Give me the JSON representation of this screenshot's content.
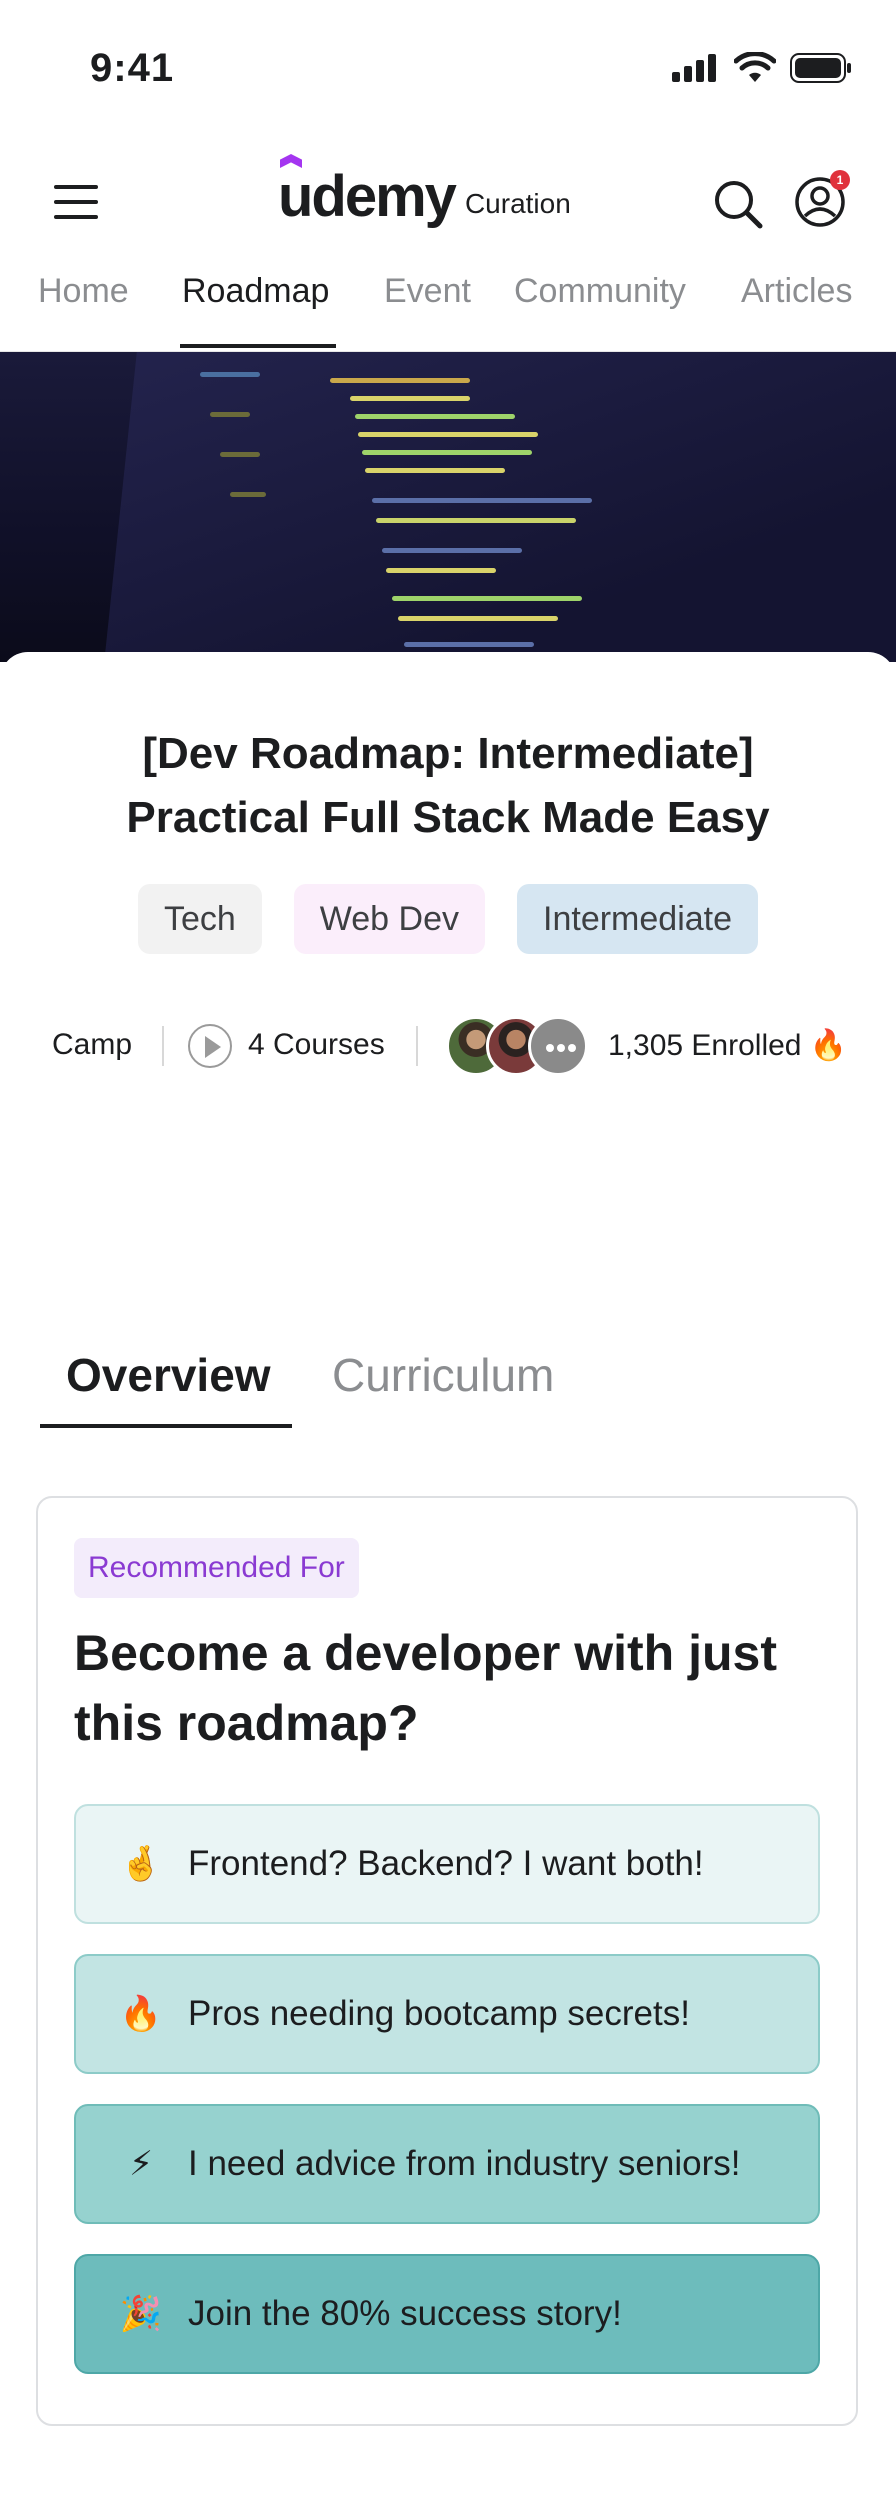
{
  "status": {
    "time": "9:41"
  },
  "header": {
    "brand": "udemy",
    "brand_sub": "Curation",
    "notification_count": "1"
  },
  "nav": {
    "tabs": [
      {
        "label": "Home"
      },
      {
        "label": "Roadmap"
      },
      {
        "label": "Event"
      },
      {
        "label": "Community"
      },
      {
        "label": "Articles"
      }
    ],
    "active": "Roadmap"
  },
  "roadmap": {
    "title_line1": "[Dev Roadmap: Intermediate]",
    "title_line2": "Practical Full Stack Made Easy",
    "tags": [
      "Tech",
      "Web Dev",
      "Intermediate"
    ],
    "type": "Camp",
    "courses": "4 Courses",
    "enrolled": "1,305 Enrolled 🔥"
  },
  "content_tabs": {
    "tabs": [
      {
        "label": "Overview"
      },
      {
        "label": "Curriculum"
      }
    ],
    "active": "Overview"
  },
  "recommended": {
    "label": "Recommended For",
    "heading": "Become a developer with just this roadmap?",
    "items": [
      {
        "emoji": "🤞",
        "text": "Frontend? Backend? I want both!"
      },
      {
        "emoji": "🔥",
        "text": "Pros needing bootcamp secrets!"
      },
      {
        "emoji": "⚡",
        "text": "I need advice from industry seniors!"
      },
      {
        "emoji": "🎉",
        "text": "Join the 80% success story!"
      }
    ]
  },
  "colors": {
    "brand_purple": "#a435f0",
    "tag_tech_bg": "#f2f2f2",
    "tag_webdev_bg": "#fbeefb",
    "tag_level_bg": "#d6e6f2",
    "recommended_label": "#8a3ad2"
  }
}
